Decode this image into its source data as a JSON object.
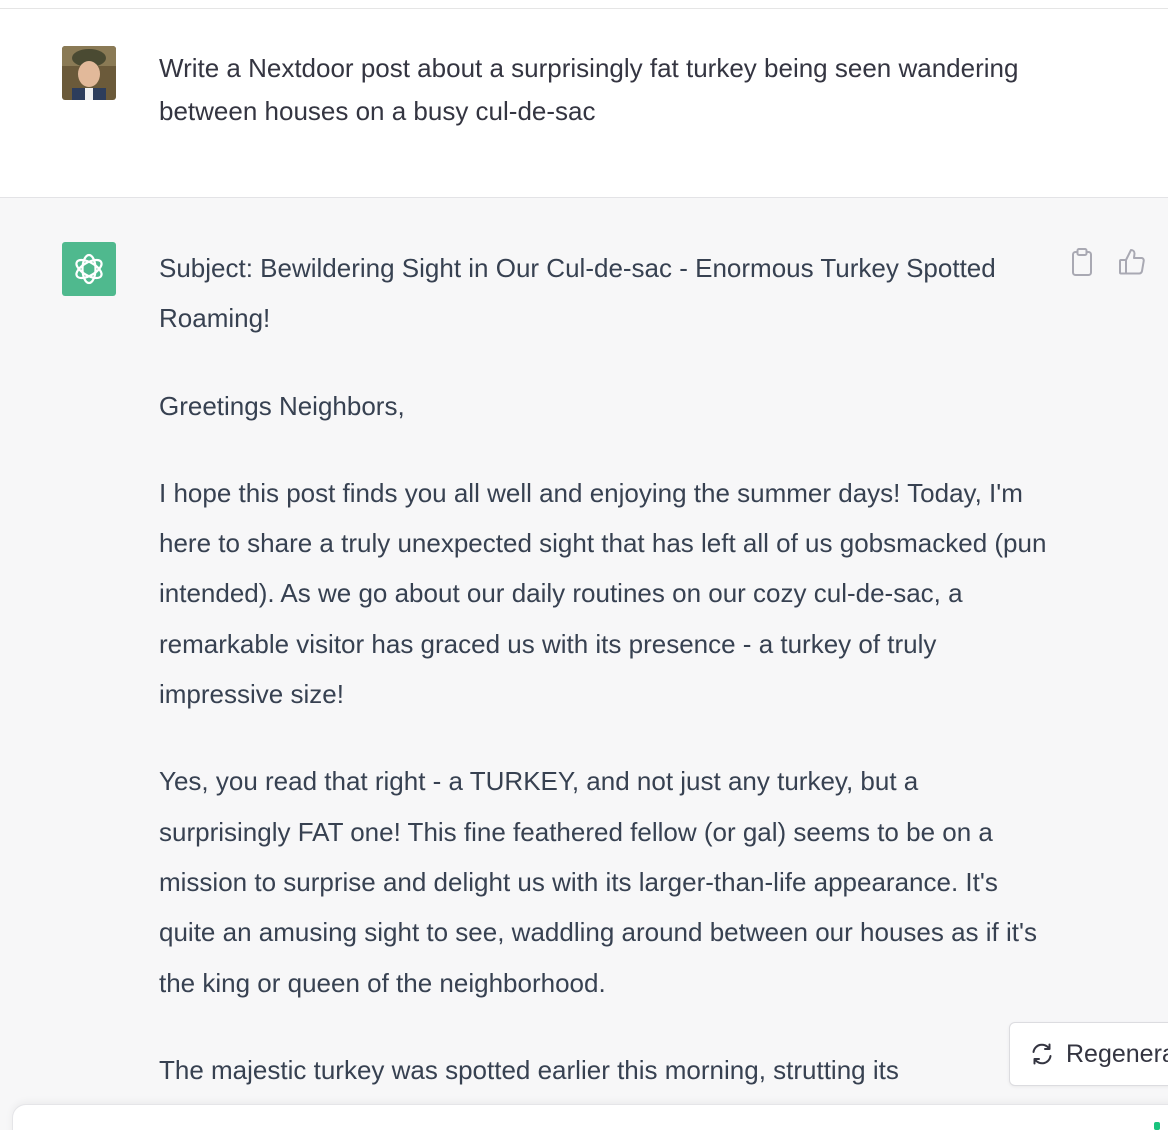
{
  "conversation": {
    "user_message": {
      "avatar": "user-avatar-photo",
      "text": "Write a Nextdoor post about a surprisingly fat turkey being seen wandering between houses on a busy cul-de-sac"
    },
    "assistant_message": {
      "avatar": "chatgpt-logo-icon",
      "accent_color": "#4fb98e",
      "paragraphs": [
        "Subject: Bewildering Sight in Our Cul-de-sac - Enormous Turkey Spotted Roaming!",
        "Greetings Neighbors,",
        "I hope this post finds you all well and enjoying the summer days! Today, I'm here to share a truly unexpected sight that has left all of us gobsmacked (pun intended). As we go about our daily routines on our cozy cul-de-sac, a remarkable visitor has graced us with its presence - a turkey of truly impressive size!",
        "Yes, you read that right - a TURKEY, and not just any turkey, but a surprisingly FAT one! This fine feathered fellow (or gal) seems to be on a mission to surprise and delight us with its larger-than-life appearance. It's quite an amusing sight to see, waddling around between our houses as if it's the king or queen of the neighborhood.",
        "The majestic turkey was spotted earlier this morning, strutting its"
      ],
      "actions": {
        "copy_icon": "clipboard-icon",
        "like_icon": "thumbs-up-icon"
      }
    }
  },
  "controls": {
    "regenerate_label": "Regenerate response",
    "regenerate_icon": "refresh-icon"
  }
}
